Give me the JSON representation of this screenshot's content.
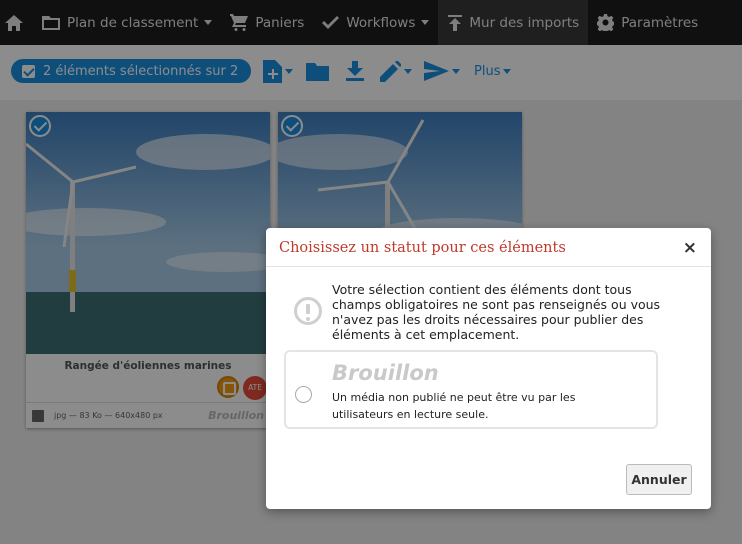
{
  "nav": {
    "items": [
      {
        "label": "",
        "icon": "home-icon"
      },
      {
        "label": "Plan de classement",
        "icon": "folder-icon",
        "dropdown": true
      },
      {
        "label": "Paniers",
        "icon": "cart-icon"
      },
      {
        "label": "Workflows",
        "icon": "check-icon",
        "dropdown": true
      },
      {
        "label": "Mur des imports",
        "icon": "upload-icon",
        "active": true
      },
      {
        "label": "Paramètres",
        "icon": "gear-icon"
      }
    ]
  },
  "toolbar": {
    "selection_label": "2 éléments sélectionnés sur 2",
    "more_label": "Plus",
    "tools": [
      "new-file-icon",
      "folder-icon",
      "download-icon",
      "edit-icon",
      "send-icon"
    ]
  },
  "cards": [
    {
      "title": "Rangée d'éoliennes marines",
      "meta": "jpg — 83 Ko — 640x480 px",
      "status": "Brouillon",
      "badge": "ATE"
    },
    {
      "title": "",
      "meta": "",
      "status": ""
    }
  ],
  "modal": {
    "title": "Choisissez un statut pour ces éléments",
    "close_label": "×",
    "warning": "Votre sélection contient des éléments dont tous champs obligatoires ne sont pas renseignés ou vous n'avez pas les droits nécessaires pour publier des éléments à cet emplacement.",
    "option_title": "Brouillon",
    "option_desc": "Un média non publié ne peut être vu par les utilisateurs en lecture seule.",
    "cancel_label": "Annuler"
  },
  "colors": {
    "accent": "#1a8fe0",
    "modal_title": "#c0392b",
    "nav_bg": "#1e1e1e"
  }
}
